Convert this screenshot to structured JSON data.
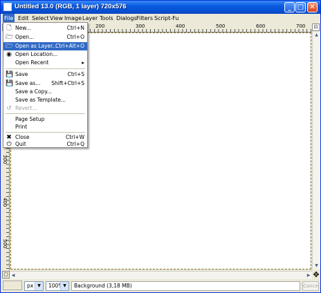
{
  "window": {
    "title": "Untitled 13.0 (RGB, 1 layer) 720x576",
    "min_icon": "minimize-icon",
    "max_icon": "maximize-icon",
    "close_icon": "close-icon"
  },
  "menubar": [
    "File",
    "Edit",
    "Select",
    "View",
    "Image",
    "Layer",
    "Tools",
    "Dialogs",
    "Filters",
    "Script-Fu"
  ],
  "ruler": {
    "h_labels": [
      "200",
      "300",
      "400",
      "500",
      "600",
      "700"
    ],
    "v_labels": [
      "300",
      "400",
      "500"
    ]
  },
  "file_menu": {
    "items": [
      {
        "label": "New...",
        "shortcut": "Ctrl+N",
        "icon": "new-document-icon"
      },
      {
        "label": "Open...",
        "shortcut": "Ctrl+O",
        "icon": "open-folder-icon"
      },
      {
        "label": "Open as Layer...",
        "shortcut": "Ctrl+Alt+O",
        "icon": "open-as-layer-icon",
        "highlighted": true
      },
      {
        "label": "Open Location...",
        "shortcut": "",
        "icon": "globe-icon"
      },
      {
        "label": "Open Recent",
        "shortcut": "",
        "submenu": true
      },
      {
        "label": "Save",
        "shortcut": "Ctrl+S",
        "icon": "save-icon"
      },
      {
        "label": "Save as...",
        "shortcut": "Shift+Ctrl+S",
        "icon": "save-as-icon"
      },
      {
        "label": "Save a Copy...",
        "shortcut": ""
      },
      {
        "label": "Save as Template...",
        "shortcut": ""
      },
      {
        "label": "Revert...",
        "shortcut": "",
        "icon": "revert-icon",
        "disabled": true
      },
      {
        "label": "Page Setup",
        "shortcut": ""
      },
      {
        "label": "Print",
        "shortcut": ""
      },
      {
        "label": "Close",
        "shortcut": "Ctrl+W",
        "icon": "close-x-icon"
      },
      {
        "label": "Quit",
        "shortcut": "Ctrl+Q",
        "icon": "quit-icon"
      }
    ]
  },
  "status": {
    "unit": "px",
    "zoom": "100%",
    "message": "Background (3,18 MB)",
    "cancel": "Cancel"
  },
  "colors": {
    "titlebar": "#0a5adf",
    "highlight": "#316ac5",
    "canvas": "#ffffff"
  }
}
